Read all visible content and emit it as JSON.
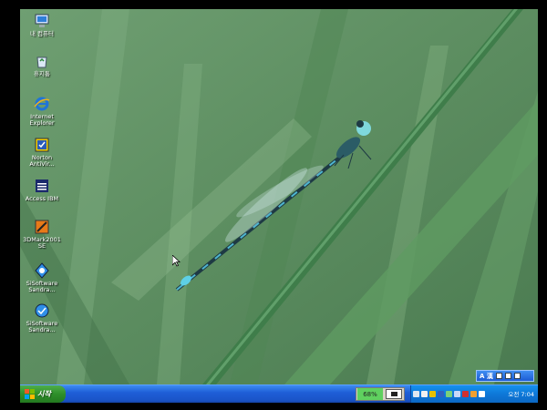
{
  "desktop": {
    "icons": [
      {
        "label": "내 컴퓨터",
        "icon": "my-computer-icon"
      },
      {
        "label": "휴지통",
        "icon": "recycle-bin-icon"
      },
      {
        "label": "Internet Explorer",
        "icon": "internet-explorer-icon"
      },
      {
        "label": "Norton AntiVir...",
        "icon": "norton-antivirus-icon"
      },
      {
        "label": "Access IBM",
        "icon": "access-ibm-icon"
      },
      {
        "label": "3DMark2001 SE",
        "icon": "3dmark-icon"
      },
      {
        "label": "SiSoftware Sandra...",
        "icon": "sisoftware-sandra-icon"
      },
      {
        "label": "SiSoftware Sandra...",
        "icon": "sisoftware-sandra-icon"
      }
    ],
    "wallpaper": "damselfly on grass blade"
  },
  "taskbar": {
    "start_label": "시작",
    "indicator_value": "68%",
    "clock": "오전 7:04"
  },
  "language_bar": {
    "label": "A 漢"
  },
  "colors": {
    "taskbar_blue": "#1f5fd8",
    "start_green": "#2e8f2a",
    "tray_blue": "#0e78d8",
    "grass_green": "#5f8f63"
  }
}
